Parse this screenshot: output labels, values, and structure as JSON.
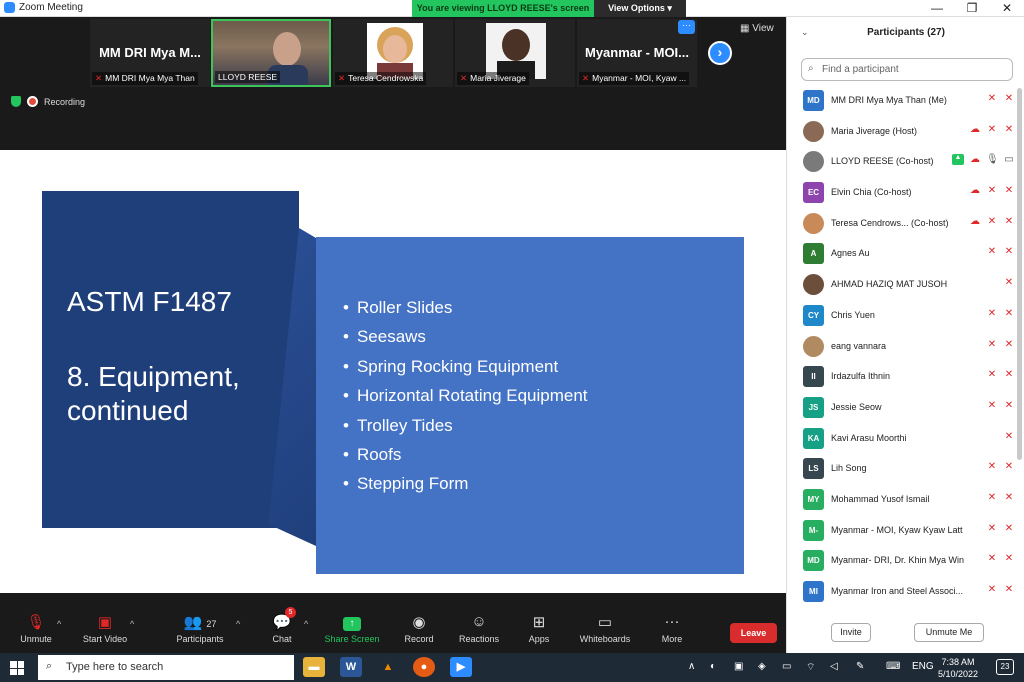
{
  "window": {
    "title": "Zoom Meeting",
    "minimize": "—",
    "maximize": "❐",
    "close": "✕"
  },
  "banner": {
    "viewing_text": "You are viewing LLOYD REESE's screen",
    "view_options": "View Options ▾"
  },
  "thumbnails": [
    {
      "big": "MM DRI Mya M...",
      "caption": "MM DRI Mya Mya Than"
    },
    {
      "big": "",
      "caption": "LLOYD REESE"
    },
    {
      "big": "",
      "caption": "Teresa Cendrowska"
    },
    {
      "big": "",
      "caption": "Maria Jiverage"
    },
    {
      "big": "Myanmar - MOI...",
      "caption": "Myanmar - MOI, Kyaw ..."
    }
  ],
  "view_label": "View",
  "recording_label": "Recording",
  "slide": {
    "title": "ASTM F1487",
    "subtitle": "8. Equipment, continued",
    "bullets": [
      "Roller Slides",
      "Seesaws",
      "Spring Rocking Equipment",
      "Horizontal Rotating Equipment",
      "Trolley Tides",
      "Roofs",
      "Stepping Form"
    ]
  },
  "toolbar": {
    "unmute": "Unmute",
    "start_video": "Start Video",
    "participants": "Participants",
    "participants_count": "27",
    "chat": "Chat",
    "chat_badge": "5",
    "share_screen": "Share Screen",
    "record": "Record",
    "reactions": "Reactions",
    "apps": "Apps",
    "whiteboards": "Whiteboards",
    "more": "More",
    "leave": "Leave"
  },
  "panel": {
    "header": "Participants (27)",
    "search_placeholder": "Find a participant",
    "invite": "Invite",
    "unmute_me": "Unmute Me",
    "participants": [
      {
        "initials": "MD",
        "color": "#2e75c9",
        "name": "MM DRI Mya Mya Than (Me)"
      },
      {
        "initials": "",
        "color": "#8a6a55",
        "name": "Maria Jiverage (Host)"
      },
      {
        "initials": "",
        "color": "#7a7a7a",
        "name": "LLOYD REESE (Co-host)"
      },
      {
        "initials": "EC",
        "color": "#8e44ad",
        "name": "Elvin Chia (Co-host)"
      },
      {
        "initials": "",
        "color": "#c98a5a",
        "name": "Teresa Cendrows... (Co-host)"
      },
      {
        "initials": "A",
        "color": "#2e7d32",
        "name": "Agnes Au"
      },
      {
        "initials": "",
        "color": "#6b4f3a",
        "name": "AHMAD HAZIQ MAT JUSOH"
      },
      {
        "initials": "CY",
        "color": "#1e88c9",
        "name": "Chris Yuen"
      },
      {
        "initials": "",
        "color": "#b08a60",
        "name": "eang vannara"
      },
      {
        "initials": "II",
        "color": "#37474f",
        "name": "Irdazulfa Ithnin"
      },
      {
        "initials": "JS",
        "color": "#16a085",
        "name": "Jessie Seow"
      },
      {
        "initials": "KA",
        "color": "#16a085",
        "name": "Kavi Arasu Moorthi"
      },
      {
        "initials": "LS",
        "color": "#37474f",
        "name": "Lih Song"
      },
      {
        "initials": "MY",
        "color": "#27ae60",
        "name": "Mohammad Yusof Ismail"
      },
      {
        "initials": "M-",
        "color": "#27ae60",
        "name": "Myanmar - MOI, Kyaw Kyaw Latt"
      },
      {
        "initials": "MD",
        "color": "#27ae60",
        "name": "Myanmar- DRI, Dr. Khin Mya Win"
      },
      {
        "initials": "MI",
        "color": "#2e75c9",
        "name": "Myanmar Iron and Steel Associ..."
      }
    ]
  },
  "taskbar": {
    "search_placeholder": "Type here to search",
    "language": "ENG",
    "time": "7:38 AM",
    "date": "5/10/2022",
    "notification_count": "23"
  }
}
